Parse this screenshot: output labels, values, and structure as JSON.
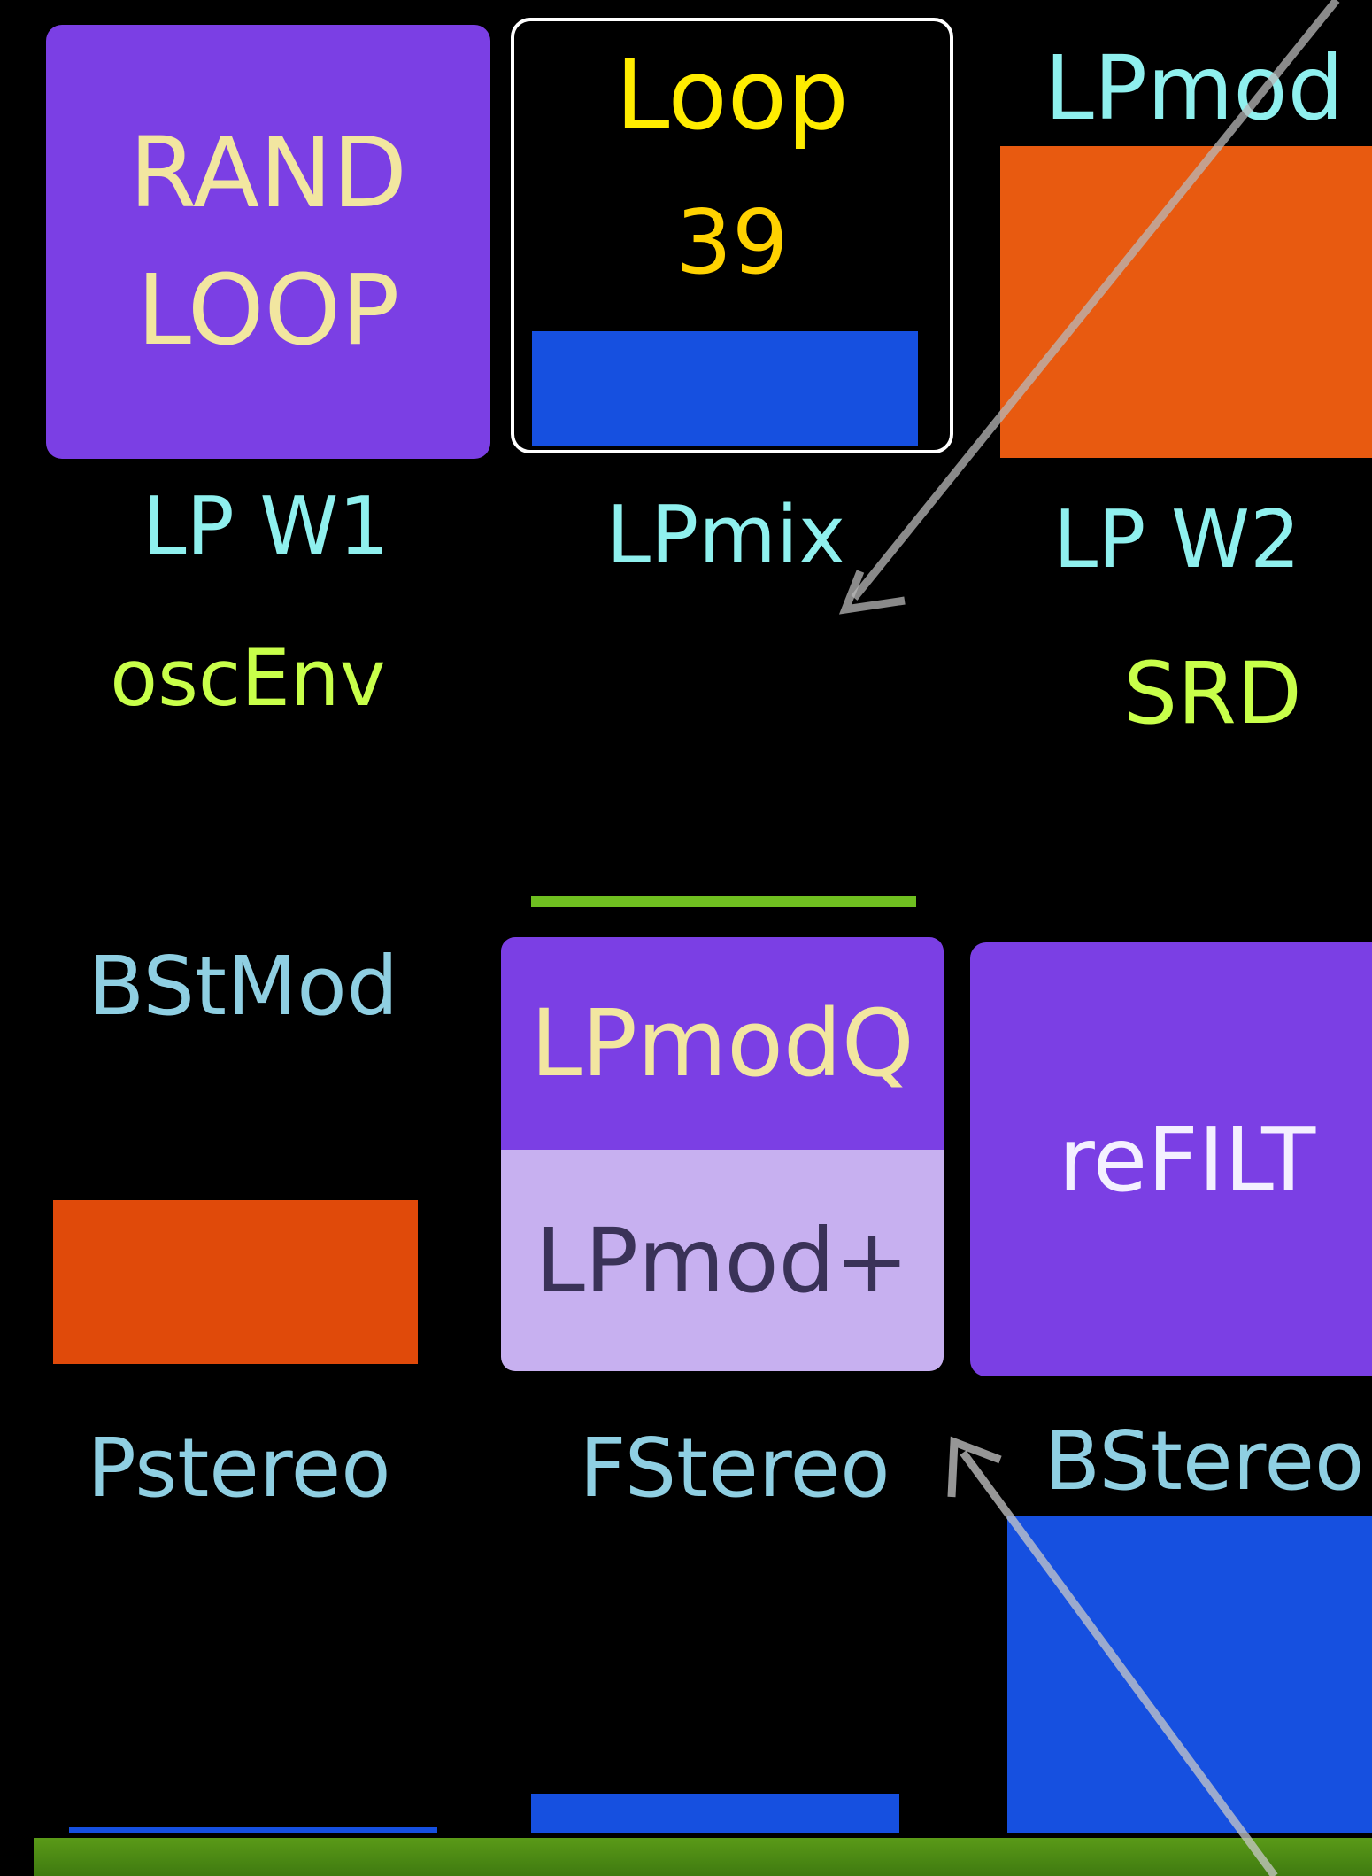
{
  "panel": {
    "rand_loop": {
      "line1": "RAND",
      "line2": "LOOP"
    },
    "loop": {
      "title": "Loop",
      "value": "39",
      "level_percent": 35
    },
    "lpmod": {
      "label": "LPmod",
      "level_percent": 100
    },
    "labels_row1": {
      "lp_w1": "LP W1",
      "lpmix": "LPmix",
      "lp_w2": "LP W2"
    },
    "labels_row2": {
      "oscenv": "oscEnv",
      "srd": "SRD"
    },
    "bstmod": {
      "label": "BStMod",
      "level_percent": 100
    },
    "lpmodq": {
      "label": "LPmodQ"
    },
    "lpmod_plus": {
      "label": "LPmod+"
    },
    "refilt": {
      "label": "reFILT"
    },
    "labels_row3": {
      "pstereo": "Pstereo",
      "fstereo": "FStereo",
      "bstereo": "BStereo"
    },
    "pstereo_level_percent": 2,
    "fstereo_level_percent": 13,
    "bstereo_level_percent": 100
  },
  "colors": {
    "purple": "#7b3fe4",
    "lilac": "#c7b0f0",
    "orange": "#e04a0a",
    "blue": "#1650e0",
    "green": "#6fbf20",
    "cyan_label": "#8ff0ee",
    "yellow": "#ffec00"
  }
}
